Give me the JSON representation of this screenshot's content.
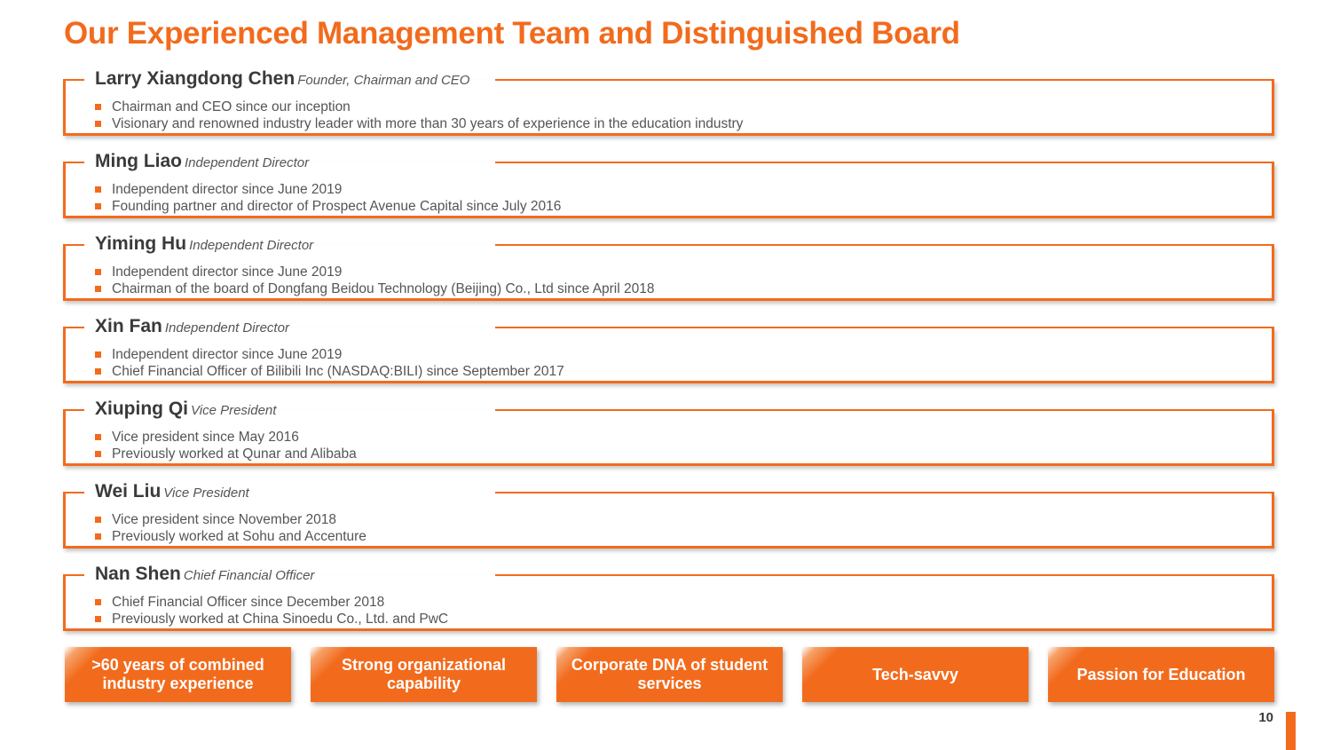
{
  "title": "Our Experienced Management Team and Distinguished Board",
  "people": [
    {
      "name": "Larry Xiangdong Chen",
      "role": "Founder, Chairman and CEO",
      "bullets": [
        "Chairman and CEO since our inception",
        "Visionary and renowned industry leader with more than 30 years of experience in the education industry"
      ]
    },
    {
      "name": "Ming Liao",
      "role": "Independent Director",
      "bullets": [
        "Independent director since June 2019",
        "Founding partner and director of Prospect Avenue Capital since July 2016"
      ]
    },
    {
      "name": "Yiming Hu",
      "role": "Independent Director",
      "bullets": [
        "Independent director since June 2019",
        "Chairman of the board of Dongfang Beidou Technology (Beijing) Co., Ltd since April 2018"
      ]
    },
    {
      "name": "Xin Fan",
      "role": "Independent Director",
      "bullets": [
        "Independent director since June 2019",
        "Chief Financial Officer of Bilibili Inc (NASDAQ:BILI) since September 2017"
      ]
    },
    {
      "name": "Xiuping Qi",
      "role": "Vice President",
      "bullets": [
        "Vice president since May 2016",
        "Previously worked at Qunar and Alibaba"
      ]
    },
    {
      "name": "Wei Liu",
      "role": "Vice President",
      "bullets": [
        "Vice president since November 2018",
        "Previously worked at Sohu and Accenture"
      ]
    },
    {
      "name": "Nan Shen",
      "role": "Chief Financial Officer",
      "bullets": [
        "Chief Financial Officer since December 2018",
        "Previously worked at China Sinoedu Co., Ltd. and PwC"
      ]
    }
  ],
  "strengths": [
    ">60 years of combined industry experience",
    "Strong organizational capability",
    "Corporate DNA of student services",
    "Tech-savvy",
    "Passion for Education"
  ],
  "page_number": "10",
  "colors": {
    "accent": "#f26b1d",
    "text": "#3a3a3a",
    "muted": "#555555"
  }
}
